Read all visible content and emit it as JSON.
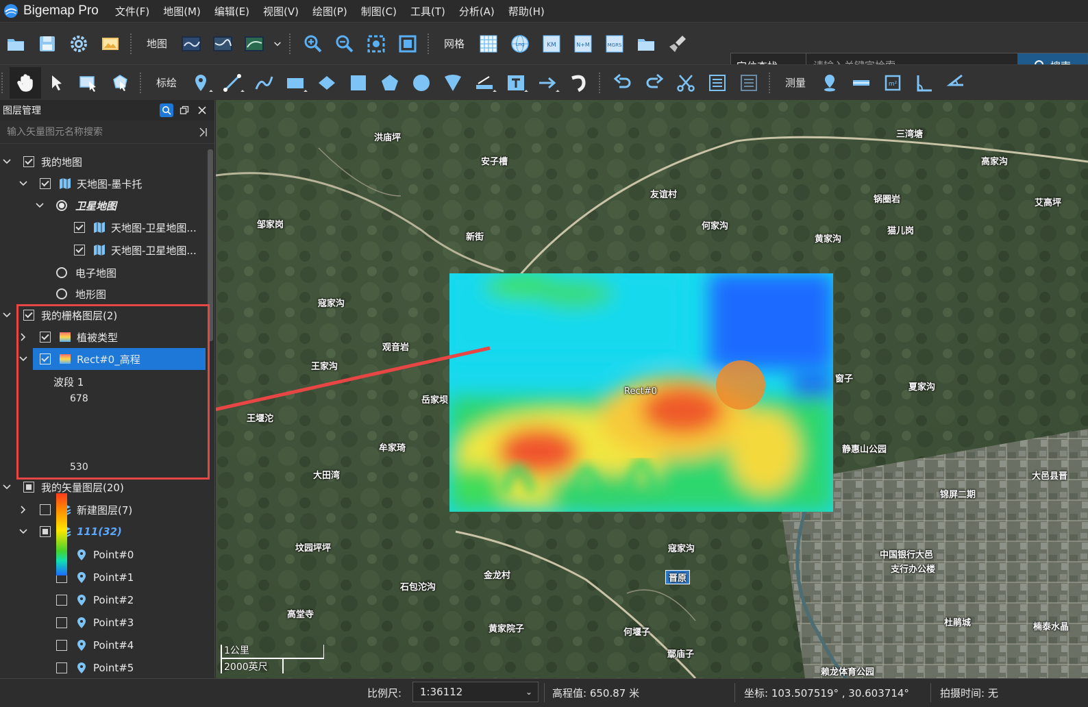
{
  "app": {
    "title": "Bigemap Pro"
  },
  "menu": [
    "文件(F)",
    "地图(M)",
    "编辑(E)",
    "视图(V)",
    "绘图(P)",
    "制图(C)",
    "工具(T)",
    "分析(A)",
    "帮助(H)"
  ],
  "toolbar1": {
    "map_label": "地图",
    "grid_label": "网格",
    "grid_icons": [
      "grid-icon",
      "lnglat-grid-icon",
      "km-grid-icon",
      "nm-grid-icon",
      "mgrs-grid-icon"
    ],
    "search_mode": "定位查找",
    "search_placeholder": "请输入关键字检索",
    "search_button": "搜索"
  },
  "toolbar2": {
    "mark_label": "标绘",
    "measure_label": "测量"
  },
  "layer_panel": {
    "title": "图层管理",
    "filter_placeholder": "输入矢量图元名称搜索",
    "tree": {
      "my_map": "我的地图",
      "tdt_mercator": "天地图-墨卡托",
      "satellite": "卫星地图",
      "sat_layer_1": "天地图-卫星地图...",
      "sat_layer_2": "天地图-卫星地图...",
      "electronic": "电子地图",
      "terrain": "地形图",
      "raster_group": "我的栅格图层(2)",
      "vegetation": "植被类型",
      "rect_elevation": "Rect#0_高程",
      "band": "波段 1",
      "legend_max": "678",
      "legend_min": "530",
      "vector_group": "我的矢量图层(20)",
      "new_layer": "新建图层(7)",
      "layer_111": "111(32)",
      "points": [
        "Point#0",
        "Point#1",
        "Point#2",
        "Point#3",
        "Point#4",
        "Point#5"
      ]
    }
  },
  "map": {
    "rect_label": "Rect#0",
    "places": [
      "洪庙坪",
      "安子槽",
      "三湾塘",
      "高家沟",
      "友谊村",
      "锅圈岩",
      "艾高坪",
      "邹家岗",
      "何家沟",
      "新街",
      "黄家沟",
      "猫儿岗",
      "寇家沟",
      "观音岩",
      "王家沟",
      "岳家坝",
      "王堰沱",
      "牟家琦",
      "大田湾",
      "窗子",
      "夏家沟",
      "静惠山公园",
      "大邑县晋",
      "锦屏二期",
      "坟园坪坪",
      "金龙村",
      "石包沱沟",
      "寇家沟",
      "中国银行大邑",
      "支行办公楼",
      "晋原",
      "高堂寺",
      "黄家院子",
      "何堰子",
      "鄢庙子",
      "杜鹃城",
      "楠泰水晶",
      "赖龙体育公园"
    ],
    "scale_top": "1公里",
    "scale_bottom": "2000英尺"
  },
  "status": {
    "scale_label": "比例尺:",
    "scale_value": "1:36112",
    "elevation": "高程值: 650.87 米",
    "coords": "坐标: 103.507519° , 30.603714°",
    "capture_time": "拍摄时间: 无"
  },
  "colors": {
    "accent": "#1e78d7",
    "annotation": "#e84545"
  }
}
